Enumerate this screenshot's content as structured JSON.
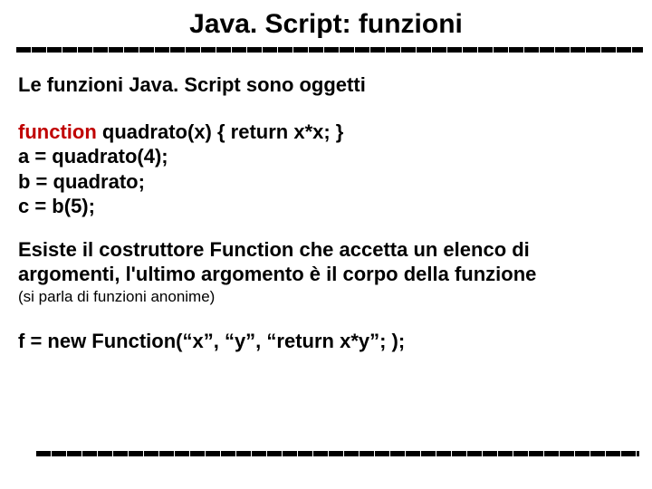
{
  "title": "Java. Script: funzioni",
  "intro": "Le funzioni Java. Script sono oggetti",
  "code": {
    "kw": "function",
    "l1_rest": " quadrato(x) { return x*x; }",
    "l2": "a = quadrato(4);",
    "l3": "b = quadrato;",
    "l4": "c = b(5);"
  },
  "para1_a": "Esiste il costruttore Function che accetta un elenco di",
  "para1_b": "argomenti, l'ultimo argomento è il corpo della funzione",
  "note": "(si parla di funzioni anonime)",
  "example": "f = new Function(“x”, “y”, “return x*y”; );"
}
